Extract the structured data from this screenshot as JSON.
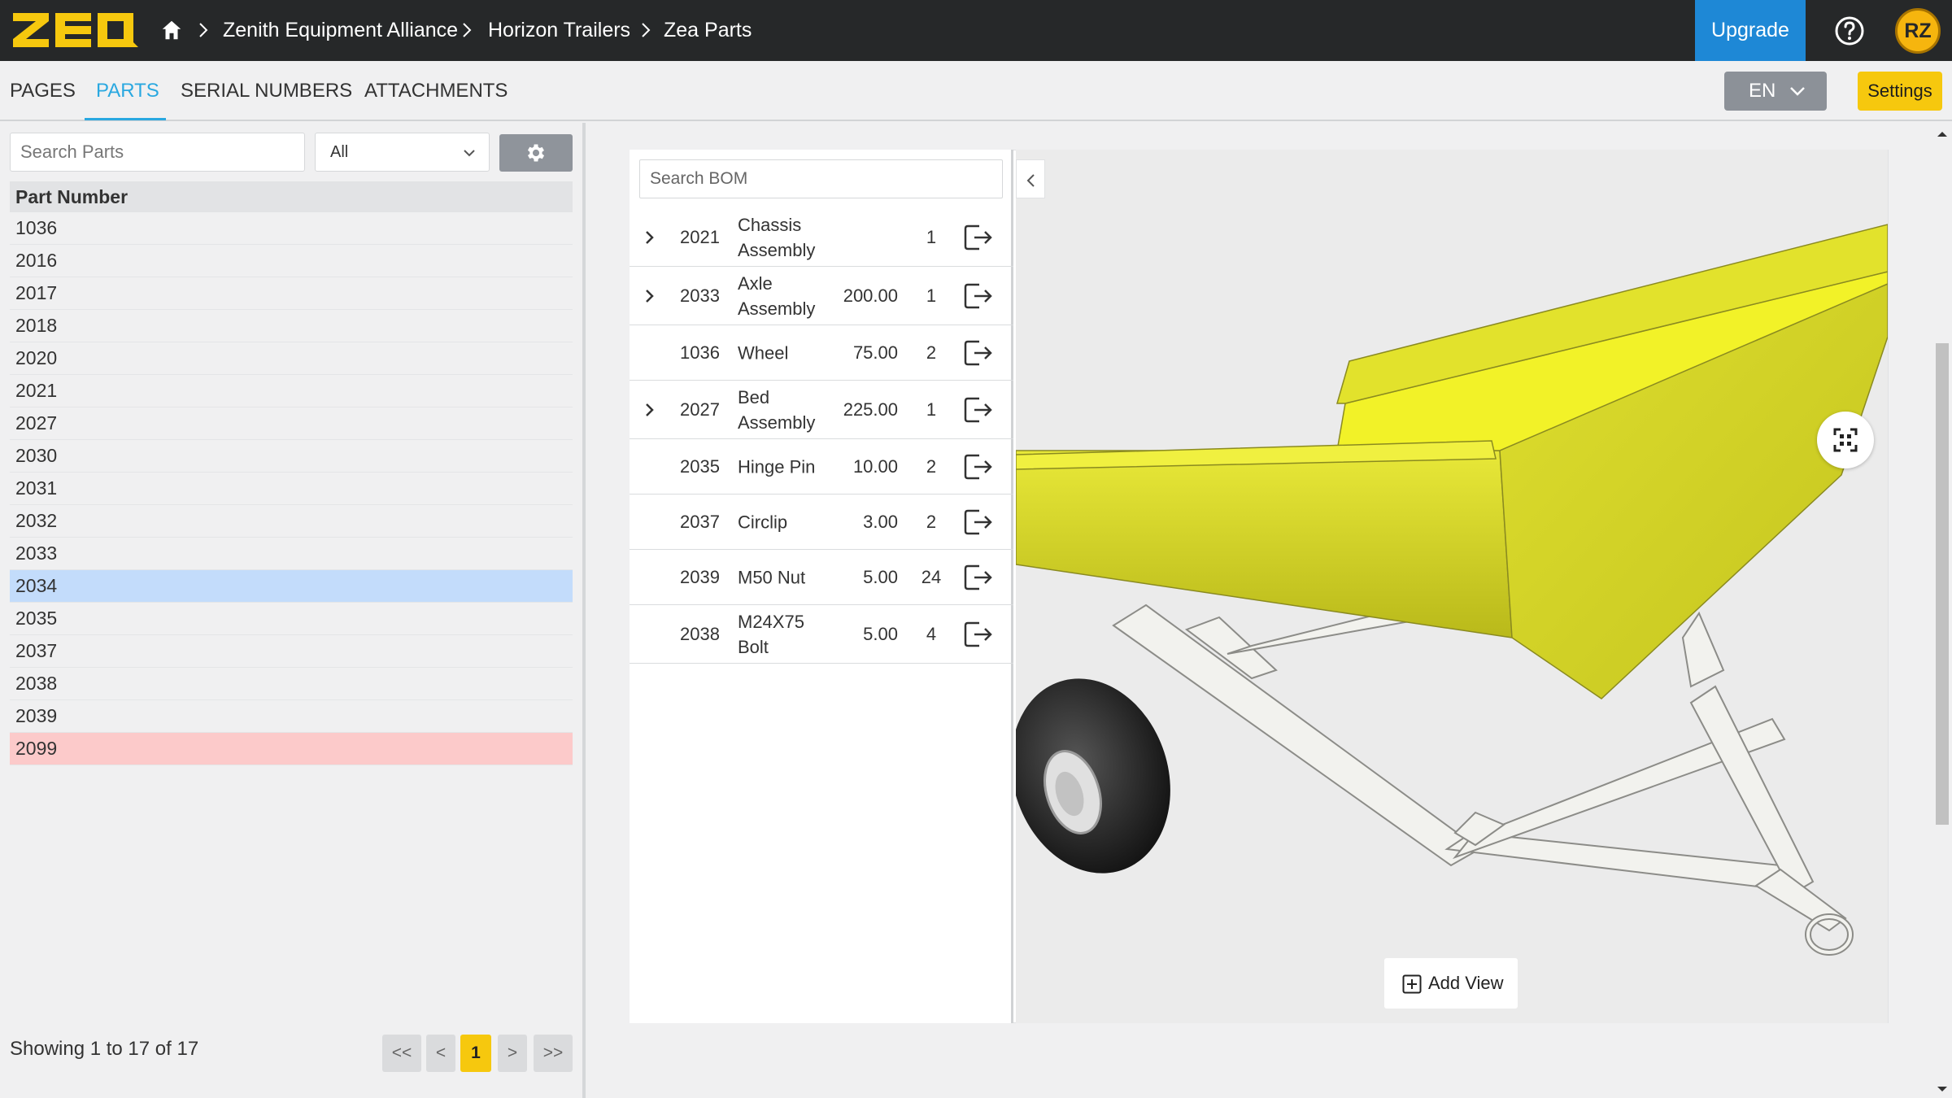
{
  "app": {
    "logo_text": "ZEA"
  },
  "breadcrumb": [
    "Zenith Equipment Alliance",
    "Horizon Trailers",
    "Zea Parts"
  ],
  "header": {
    "upgrade_label": "Upgrade",
    "avatar_initials": "RZ"
  },
  "tabs": [
    {
      "label": "PAGES",
      "active": false
    },
    {
      "label": "PARTS",
      "active": true
    },
    {
      "label": "SERIAL NUMBERS",
      "active": false
    },
    {
      "label": "ATTACHMENTS",
      "active": false
    }
  ],
  "language": {
    "value": "EN"
  },
  "settings_label": "Settings",
  "parts_panel": {
    "search_placeholder": "Search Parts",
    "filter_value": "All",
    "column_header": "Part Number",
    "rows": [
      {
        "part": "1036",
        "state": ""
      },
      {
        "part": "2016",
        "state": ""
      },
      {
        "part": "2017",
        "state": ""
      },
      {
        "part": "2018",
        "state": ""
      },
      {
        "part": "2020",
        "state": ""
      },
      {
        "part": "2021",
        "state": ""
      },
      {
        "part": "2027",
        "state": ""
      },
      {
        "part": "2030",
        "state": ""
      },
      {
        "part": "2031",
        "state": ""
      },
      {
        "part": "2032",
        "state": ""
      },
      {
        "part": "2033",
        "state": ""
      },
      {
        "part": "2034",
        "state": "selected"
      },
      {
        "part": "2035",
        "state": ""
      },
      {
        "part": "2037",
        "state": ""
      },
      {
        "part": "2038",
        "state": ""
      },
      {
        "part": "2039",
        "state": ""
      },
      {
        "part": "2099",
        "state": "error"
      }
    ],
    "showing_text": "Showing 1 to 17 of 17",
    "pager": {
      "first": "<<",
      "prev": "<",
      "current": "1",
      "next": ">",
      "last": ">>"
    }
  },
  "bom": {
    "search_placeholder": "Search BOM",
    "rows": [
      {
        "part": "2021",
        "description": "Chassis Assembly",
        "price": "",
        "qty": "1",
        "expandable": true
      },
      {
        "part": "2033",
        "description": "Axle Assembly",
        "price": "200.00",
        "qty": "1",
        "expandable": true
      },
      {
        "part": "1036",
        "description": "Wheel",
        "price": "75.00",
        "qty": "2",
        "expandable": false
      },
      {
        "part": "2027",
        "description": "Bed Assembly",
        "price": "225.00",
        "qty": "1",
        "expandable": true
      },
      {
        "part": "2035",
        "description": "Hinge Pin",
        "price": "10.00",
        "qty": "2",
        "expandable": false
      },
      {
        "part": "2037",
        "description": "Circlip",
        "price": "3.00",
        "qty": "2",
        "expandable": false
      },
      {
        "part": "2039",
        "description": "M50 Nut",
        "price": "5.00",
        "qty": "24",
        "expandable": false
      },
      {
        "part": "2038",
        "description": "M24X75 Bolt",
        "price": "5.00",
        "qty": "4",
        "expandable": false
      }
    ]
  },
  "viewer": {
    "add_view_label": "Add View"
  },
  "colors": {
    "topbar": "#262829",
    "accent_blue": "#2aa8e0",
    "upgrade_blue": "#1e88d6",
    "accent_yellow": "#f6c80e",
    "selected_row": "#c3dcfb",
    "error_row": "#fccaca"
  },
  "icons": [
    "home-icon",
    "chevron-right-icon",
    "help-icon",
    "chevron-down-icon",
    "gear-icon",
    "chevron-left-icon",
    "exit-icon",
    "fit-view-icon",
    "add-box-icon"
  ]
}
